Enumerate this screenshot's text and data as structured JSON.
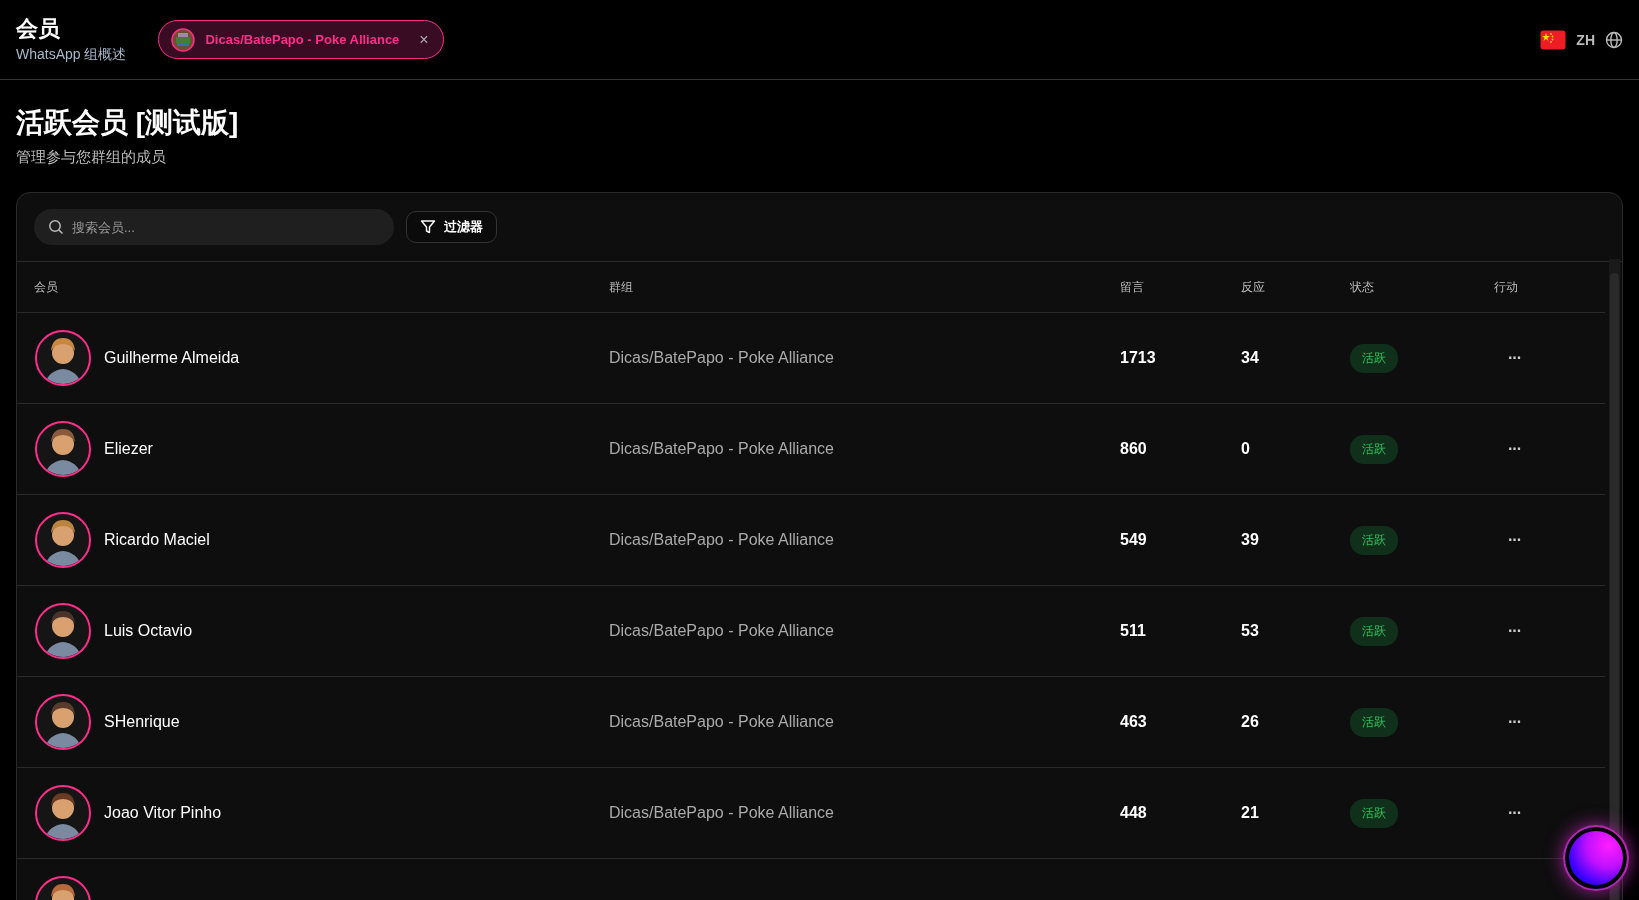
{
  "header": {
    "title": "会员",
    "subtitle": "WhatsApp 组概述",
    "group_chip": {
      "label": "Dicas/BatePapo - Poke Alliance",
      "close": "×"
    },
    "language": "ZH"
  },
  "page": {
    "title": "活跃会员 [测试版]",
    "subtitle": "管理参与您群组的成员"
  },
  "toolbar": {
    "search": {
      "placeholder": "搜索会员..."
    },
    "filter_button": "过滤器"
  },
  "table": {
    "columns": [
      "会员",
      "群组",
      "留言",
      "反应",
      "状态",
      "行动"
    ],
    "rows": [
      {
        "name": "Guilherme Almeida",
        "group": "Dicas/BatePapo - Poke Alliance",
        "messages": "1713",
        "reactions": "34",
        "status": "活跃",
        "actions": "···",
        "color": "#c8873e"
      },
      {
        "name": "Eliezer",
        "group": "Dicas/BatePapo - Poke Alliance",
        "messages": "860",
        "reactions": "0",
        "status": "活跃",
        "actions": "···",
        "color": "#8a5a3a"
      },
      {
        "name": "Ricardo Maciel",
        "group": "Dicas/BatePapo - Poke Alliance",
        "messages": "549",
        "reactions": "39",
        "status": "活跃",
        "actions": "···",
        "color": "#b8843e"
      },
      {
        "name": "Luis Octavio",
        "group": "Dicas/BatePapo - Poke Alliance",
        "messages": "511",
        "reactions": "53",
        "status": "活跃",
        "actions": "···",
        "color": "#4a3328"
      },
      {
        "name": "SHenrique",
        "group": "Dicas/BatePapo - Poke Alliance",
        "messages": "463",
        "reactions": "26",
        "status": "活跃",
        "actions": "···",
        "color": "#5a3a2a"
      },
      {
        "name": "Joao Vitor Pinho",
        "group": "Dicas/BatePapo - Poke Alliance",
        "messages": "448",
        "reactions": "21",
        "status": "活跃",
        "actions": "···",
        "color": "#6a3a22"
      },
      {
        "kind": "cut",
        "color": "#b86a3a"
      }
    ]
  }
}
